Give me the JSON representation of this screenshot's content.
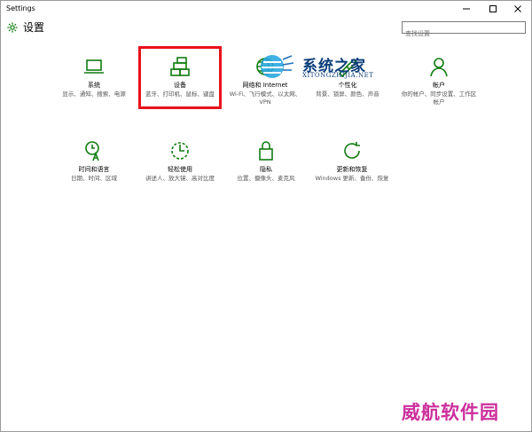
{
  "window": {
    "title": "Settings"
  },
  "header": {
    "title": "设置"
  },
  "search": {
    "placeholder": "查找设置"
  },
  "tiles": [
    {
      "name": "系统",
      "desc": "显示、通知、搜索、电源"
    },
    {
      "name": "设备",
      "desc": "蓝牙、打印机、鼠标、键盘"
    },
    {
      "name": "网络和 Internet",
      "desc": "Wi-Fi、飞行模式、以太网、VPN"
    },
    {
      "name": "个性化",
      "desc": "背景、锁屏、颜色、声音"
    },
    {
      "name": "帐户",
      "desc": "你的帐户、同步设置、工作区帐户"
    },
    {
      "name": "时间和语言",
      "desc": "日期、时间、区域"
    },
    {
      "name": "轻松使用",
      "desc": "讲述人、放大镜、高对比度"
    },
    {
      "name": "隐私",
      "desc": "位置、摄像头、麦克风"
    },
    {
      "name": "更新和恢复",
      "desc": "Windows 更新、备份、恢复"
    }
  ],
  "watermark": {
    "title": "系统之家",
    "sub": "XITONGZHIJIA.NET"
  },
  "brand": "威航软件园",
  "colors": {
    "accent": "#107c10",
    "highlight": "#e8121a",
    "brand": "#cc2f9c"
  },
  "icons": [
    "gear-icon",
    "laptop-icon",
    "devices-icon",
    "globe-icon",
    "paint-icon",
    "person-icon",
    "time-language-icon",
    "ease-of-access-icon",
    "lock-icon",
    "refresh-icon"
  ]
}
